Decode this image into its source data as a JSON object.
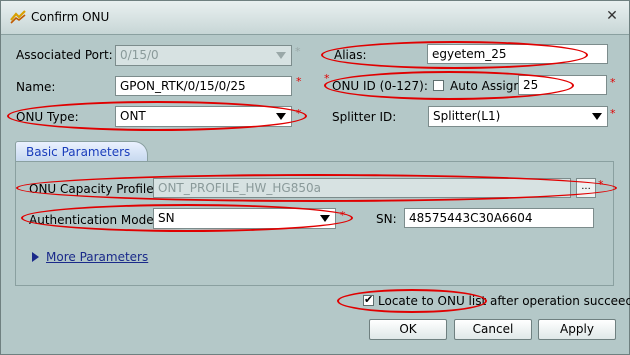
{
  "window": {
    "title": "Confirm ONU",
    "close_glyph": "✕"
  },
  "form": {
    "associated_port_label": "Associated Port:",
    "associated_port_value": "0/15/0",
    "alias_label": "Alias:",
    "alias_value": "egyetem_25",
    "name_label": "Name:",
    "name_value": "GPON_RTK/0/15/0/25",
    "onu_id_label": "ONU ID (0-127):",
    "auto_assign_label": "Auto Assign",
    "auto_assign_checked": false,
    "onu_id_value": "25",
    "onu_type_label": "ONU Type:",
    "onu_type_value": "ONT",
    "splitter_id_label": "Splitter ID:",
    "splitter_id_value": "Splitter(L1)",
    "required_mark": "*"
  },
  "basic": {
    "tab_label": "Basic Parameters",
    "capacity_profile_label": "ONU Capacity Profile:",
    "capacity_profile_value": "ONT_PROFILE_HW_HG850a",
    "browse_label": "...",
    "auth_mode_label": "Authentication Mode:",
    "auth_mode_value": "SN",
    "sn_label": "SN:",
    "sn_value": "48575443C30A6604",
    "more_params_label": "More Parameters"
  },
  "footer": {
    "locate_label": "Locate to ONU list after operation succeeds",
    "locate_checked": true,
    "check_glyph": "✔",
    "ok_label": "OK",
    "cancel_label": "Cancel",
    "apply_label": "Apply"
  },
  "colors": {
    "annotation": "#e00000",
    "dialog_bg": "#b4c8c8",
    "tab_text": "#1a3dbb"
  }
}
